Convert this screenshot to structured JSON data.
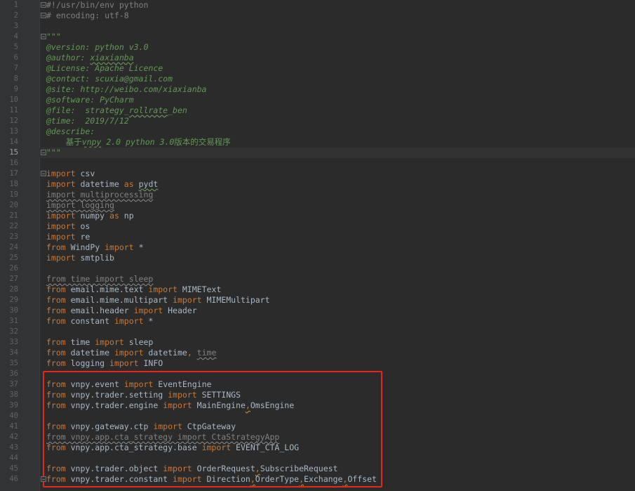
{
  "current_line": 15,
  "lines": [
    {
      "n": "1",
      "parts": [
        [
          "cm",
          "#!/usr/bin/env python"
        ]
      ],
      "fold": true
    },
    {
      "n": "2",
      "parts": [
        [
          "cm",
          "# encoding: utf-8"
        ]
      ],
      "fold": true
    },
    {
      "n": "3",
      "parts": []
    },
    {
      "n": "4",
      "parts": [
        [
          "doc",
          "\"\"\""
        ]
      ],
      "fold": true
    },
    {
      "n": "5",
      "parts": [
        [
          "doc",
          "@version: python v3.0"
        ]
      ]
    },
    {
      "n": "6",
      "parts": [
        [
          "doc",
          "@author: "
        ],
        [
          "doc typo",
          "xiaxianba"
        ]
      ]
    },
    {
      "n": "7",
      "parts": [
        [
          "doc",
          "@License: Apache Licence"
        ]
      ]
    },
    {
      "n": "8",
      "parts": [
        [
          "doc",
          "@contact: scuxia@gmail.com"
        ]
      ]
    },
    {
      "n": "9",
      "parts": [
        [
          "doc",
          "@site: http://weibo.com/xiaxianba"
        ]
      ]
    },
    {
      "n": "10",
      "parts": [
        [
          "doc",
          "@software: PyCharm"
        ]
      ]
    },
    {
      "n": "11",
      "parts": [
        [
          "doc",
          "@file:  strategy_"
        ],
        [
          "doc typo",
          "rollrate"
        ],
        [
          "doc",
          "_ben"
        ]
      ]
    },
    {
      "n": "12",
      "parts": [
        [
          "doc",
          "@time:  2019/7/12"
        ]
      ]
    },
    {
      "n": "13",
      "parts": [
        [
          "doc",
          "@describe:"
        ]
      ]
    },
    {
      "n": "14",
      "parts": [
        [
          "doc",
          "    "
        ],
        [
          "doc cjk",
          "基于"
        ],
        [
          "doc typo",
          "vnpy"
        ],
        [
          "doc",
          " 2.0 python 3.0"
        ],
        [
          "doc cjk",
          "版本的交易程序"
        ]
      ]
    },
    {
      "n": "15",
      "parts": [
        [
          "doc",
          "\"\"\""
        ]
      ],
      "fold": true
    },
    {
      "n": "16",
      "parts": []
    },
    {
      "n": "17",
      "parts": [
        [
          "kw",
          "import"
        ],
        [
          "",
          " csv"
        ]
      ],
      "fold": true
    },
    {
      "n": "18",
      "parts": [
        [
          "kw",
          "import"
        ],
        [
          "",
          " datetime "
        ],
        [
          "kw",
          "as"
        ],
        [
          "",
          " "
        ],
        [
          "typo",
          "pydt"
        ]
      ]
    },
    {
      "n": "19",
      "parts": [
        [
          "unused",
          "import multiprocessing"
        ]
      ]
    },
    {
      "n": "20",
      "parts": [
        [
          "unused",
          "import logging"
        ]
      ]
    },
    {
      "n": "21",
      "parts": [
        [
          "kw",
          "import"
        ],
        [
          "",
          " numpy "
        ],
        [
          "kw",
          "as"
        ],
        [
          "",
          " np"
        ]
      ]
    },
    {
      "n": "22",
      "parts": [
        [
          "kw",
          "import"
        ],
        [
          "",
          " os"
        ]
      ]
    },
    {
      "n": "23",
      "parts": [
        [
          "kw",
          "import"
        ],
        [
          "",
          " re"
        ]
      ]
    },
    {
      "n": "24",
      "parts": [
        [
          "kw",
          "from"
        ],
        [
          "",
          " WindPy "
        ],
        [
          "kw",
          "import"
        ],
        [
          "",
          " *"
        ]
      ]
    },
    {
      "n": "25",
      "parts": [
        [
          "kw",
          "import"
        ],
        [
          "",
          " smtplib"
        ]
      ]
    },
    {
      "n": "26",
      "parts": []
    },
    {
      "n": "27",
      "parts": [
        [
          "unused",
          "from time import sleep"
        ]
      ]
    },
    {
      "n": "28",
      "parts": [
        [
          "kw",
          "from"
        ],
        [
          "",
          " email.mime.text "
        ],
        [
          "kw",
          "import"
        ],
        [
          "",
          " MIMEText"
        ]
      ]
    },
    {
      "n": "29",
      "parts": [
        [
          "kw",
          "from"
        ],
        [
          "",
          " email.mime.multipart "
        ],
        [
          "kw",
          "import"
        ],
        [
          "",
          " MIMEMultipart"
        ]
      ]
    },
    {
      "n": "30",
      "parts": [
        [
          "kw",
          "from"
        ],
        [
          "",
          " email.header "
        ],
        [
          "kw",
          "import"
        ],
        [
          "",
          " Header"
        ]
      ]
    },
    {
      "n": "31",
      "parts": [
        [
          "kw",
          "from"
        ],
        [
          "",
          " constant "
        ],
        [
          "kw",
          "import"
        ],
        [
          "",
          " *"
        ]
      ]
    },
    {
      "n": "32",
      "parts": []
    },
    {
      "n": "33",
      "parts": [
        [
          "kw",
          "from"
        ],
        [
          "",
          " time "
        ],
        [
          "kw",
          "import"
        ],
        [
          "",
          " sleep"
        ]
      ]
    },
    {
      "n": "34",
      "parts": [
        [
          "kw",
          "from"
        ],
        [
          "",
          " datetime "
        ],
        [
          "kw",
          "import"
        ],
        [
          "",
          " datetime"
        ],
        [
          "kw",
          ", "
        ],
        [
          "unused",
          "time"
        ]
      ]
    },
    {
      "n": "35",
      "parts": [
        [
          "kw",
          "from"
        ],
        [
          "",
          " logging "
        ],
        [
          "kw",
          "import"
        ],
        [
          "",
          " INFO"
        ]
      ]
    },
    {
      "n": "36",
      "parts": []
    },
    {
      "n": "37",
      "parts": [
        [
          "kw",
          "from"
        ],
        [
          "",
          " vnpy.event "
        ],
        [
          "kw",
          "import"
        ],
        [
          "",
          " EventEngine"
        ]
      ]
    },
    {
      "n": "38",
      "parts": [
        [
          "kw",
          "from"
        ],
        [
          "",
          " vnpy.trader.setting "
        ],
        [
          "kw",
          "import"
        ],
        [
          "",
          " SETTINGS"
        ]
      ]
    },
    {
      "n": "39",
      "parts": [
        [
          "kw",
          "from"
        ],
        [
          "",
          " vnpy.trader.engine "
        ],
        [
          "kw",
          "import"
        ],
        [
          "",
          " MainEngine"
        ],
        [
          "warn-comma",
          ","
        ],
        [
          "",
          "OmsEngine"
        ]
      ]
    },
    {
      "n": "40",
      "parts": []
    },
    {
      "n": "41",
      "parts": [
        [
          "kw",
          "from"
        ],
        [
          "",
          " vnpy.gateway.ctp "
        ],
        [
          "kw",
          "import"
        ],
        [
          "",
          " CtpGateway"
        ]
      ]
    },
    {
      "n": "42",
      "parts": [
        [
          "unused",
          "from vnpy.app.cta_strategy import CtaStrategyApp"
        ]
      ]
    },
    {
      "n": "43",
      "parts": [
        [
          "kw",
          "from"
        ],
        [
          "",
          " vnpy.app.cta_strategy.base "
        ],
        [
          "kw",
          "import"
        ],
        [
          "",
          " EVENT_CTA_LOG"
        ]
      ]
    },
    {
      "n": "44",
      "parts": []
    },
    {
      "n": "45",
      "parts": [
        [
          "kw",
          "from"
        ],
        [
          "",
          " vnpy.trader.object "
        ],
        [
          "kw",
          "import"
        ],
        [
          "",
          " OrderRequest"
        ],
        [
          "warn-comma",
          ","
        ],
        [
          "",
          "SubscribeRequest"
        ]
      ]
    },
    {
      "n": "46",
      "parts": [
        [
          "kw",
          "from"
        ],
        [
          "",
          " vnpy.trader.constant "
        ],
        [
          "kw",
          "import"
        ],
        [
          "",
          " Direction"
        ],
        [
          "warn-comma",
          ","
        ],
        [
          "",
          "OrderType"
        ],
        [
          "warn-comma",
          ","
        ],
        [
          "",
          "Exchange"
        ],
        [
          "warn-comma",
          ","
        ],
        [
          "",
          "Offset"
        ]
      ],
      "fold": true
    }
  ]
}
